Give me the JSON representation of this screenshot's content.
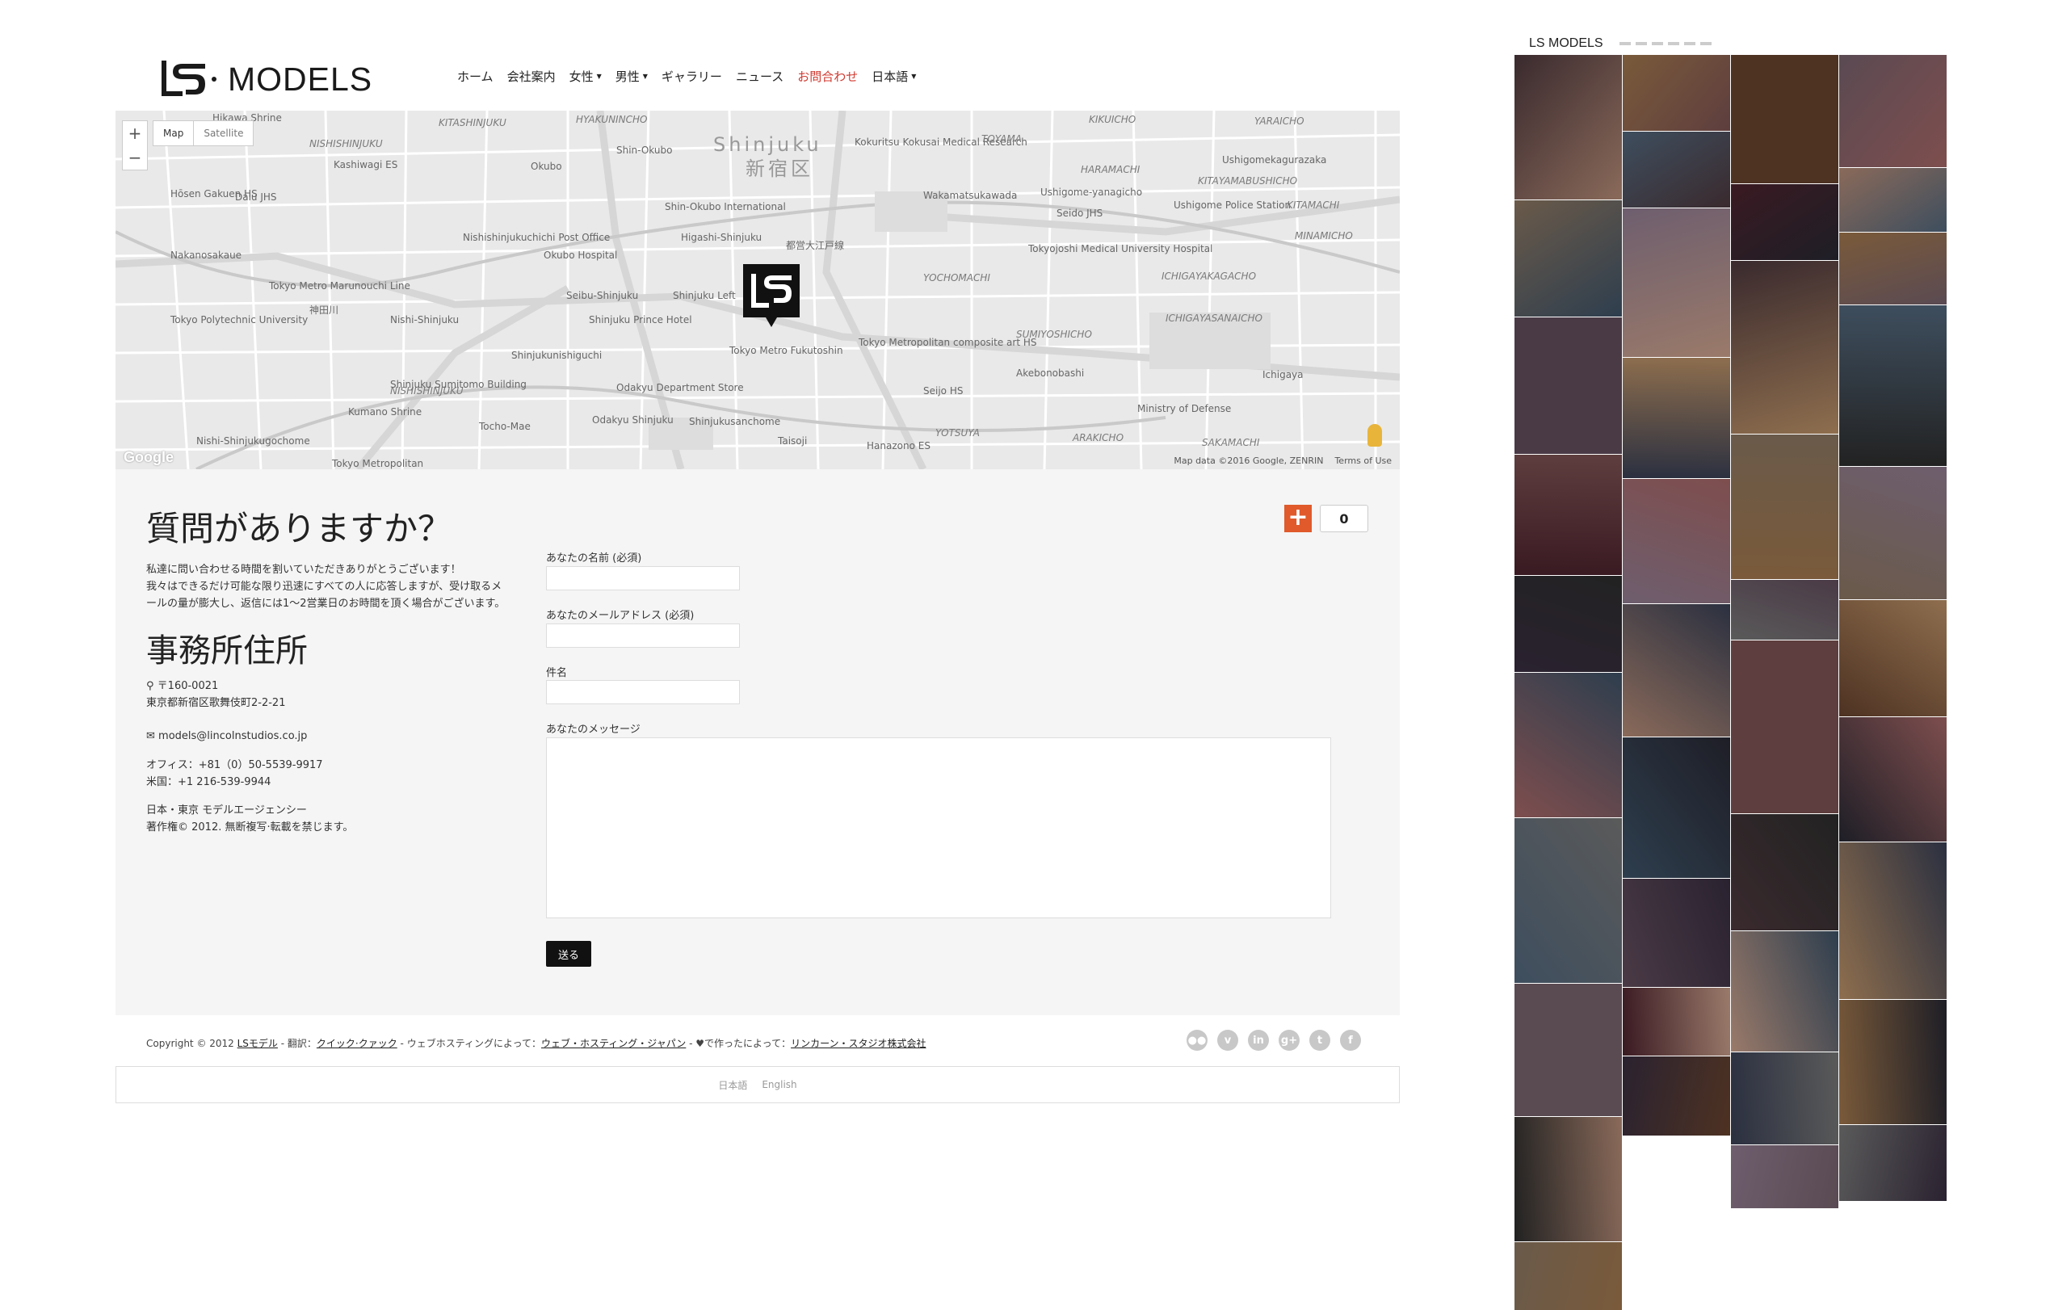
{
  "header": {
    "logo_text": "MODELS",
    "nav": [
      {
        "label": "ホーム",
        "dropdown": false,
        "active": false
      },
      {
        "label": "会社案内",
        "dropdown": false,
        "active": false
      },
      {
        "label": "女性",
        "dropdown": true,
        "active": false
      },
      {
        "label": "男性",
        "dropdown": true,
        "active": false
      },
      {
        "label": "ギャラリー",
        "dropdown": false,
        "active": false
      },
      {
        "label": "ニュース",
        "dropdown": false,
        "active": false
      },
      {
        "label": "お問合わせ",
        "dropdown": false,
        "active": true
      },
      {
        "label": "日本語",
        "dropdown": true,
        "active": false
      }
    ]
  },
  "map": {
    "zoom_in": "+",
    "zoom_out": "−",
    "type_map": "Map",
    "type_satellite": "Satellite",
    "google_logo": "Google",
    "attribution": "Map data ©2016 Google, ZENRIN",
    "terms": "Terms of Use",
    "labels": [
      {
        "t": "Hikawa Shrine",
        "c": ""
      },
      {
        "t": "NISHISHINJUKU",
        "c": "it"
      },
      {
        "t": "HYAKUNINCHO",
        "c": "it"
      },
      {
        "t": "KITASHINJUKU",
        "c": "it"
      },
      {
        "t": "Shinjuku",
        "c": "big"
      },
      {
        "t": "新宿区",
        "c": "big"
      },
      {
        "t": "KIKUICHO",
        "c": "it"
      },
      {
        "t": "YARAICHO",
        "c": "it"
      },
      {
        "t": "Kashiwagi ES",
        "c": ""
      },
      {
        "t": "Okubo",
        "c": ""
      },
      {
        "t": "Shin-Okubo",
        "c": ""
      },
      {
        "t": "Kokuritsu Kokusai Medical Research",
        "c": ""
      },
      {
        "t": "TOYAMA",
        "c": "it"
      },
      {
        "t": "HARAMACHI",
        "c": "it"
      },
      {
        "t": "KITAYAMABUSHICHO",
        "c": "it"
      },
      {
        "t": "Ushigomekagurazaka",
        "c": ""
      },
      {
        "t": "Hōsen Gakuen HS",
        "c": ""
      },
      {
        "t": "Daiu JHS",
        "c": ""
      },
      {
        "t": "Shin-Okubo International",
        "c": ""
      },
      {
        "t": "Wakamatsukawada",
        "c": ""
      },
      {
        "t": "Ushigome-yanagicho",
        "c": ""
      },
      {
        "t": "Ushigome Police Station",
        "c": ""
      },
      {
        "t": "KITAMACHI",
        "c": "it"
      },
      {
        "t": "Nishishinjukuchichi Post Office",
        "c": ""
      },
      {
        "t": "Higashi-Shinjuku",
        "c": ""
      },
      {
        "t": "都営大江戸線",
        "c": ""
      },
      {
        "t": "Seido JHS",
        "c": ""
      },
      {
        "t": "MINAMICHO",
        "c": "it"
      },
      {
        "t": "Nakanosakaue",
        "c": ""
      },
      {
        "t": "Tokyo Metro Marunouchi Line",
        "c": ""
      },
      {
        "t": "Okubo Hospital",
        "c": ""
      },
      {
        "t": "Tokyojoshi Medical University Hospital",
        "c": ""
      },
      {
        "t": "YOCHOMACHI",
        "c": "it"
      },
      {
        "t": "ICHIGAYAKAGACHO",
        "c": "it"
      },
      {
        "t": "Seibu-Shinjuku",
        "c": ""
      },
      {
        "t": "Shinjuku Prince Hotel",
        "c": ""
      },
      {
        "t": "Shinjuku Left",
        "c": ""
      },
      {
        "t": "神田川",
        "c": ""
      },
      {
        "t": "Tokyo Polytechnic University",
        "c": ""
      },
      {
        "t": "Nishi-Shinjuku",
        "c": ""
      },
      {
        "t": "ICHIGAYASANAICHO",
        "c": "it"
      },
      {
        "t": "SUMIYOSHICHO",
        "c": "it"
      },
      {
        "t": "Shinjukunishiguchi",
        "c": ""
      },
      {
        "t": "Tokyo Metropolitan composite art HS",
        "c": ""
      },
      {
        "t": "NISHISHINJUKU",
        "c": "it"
      },
      {
        "t": "Shinjuku Sumitomo Building",
        "c": ""
      },
      {
        "t": "Odakyu Department Store",
        "c": ""
      },
      {
        "t": "Akebonobashi",
        "c": ""
      },
      {
        "t": "Ichigaya",
        "c": ""
      },
      {
        "t": "Kumano Shrine",
        "c": ""
      },
      {
        "t": "Tocho-Mae",
        "c": ""
      },
      {
        "t": "Seijo HS",
        "c": ""
      },
      {
        "t": "Ministry of Defense",
        "c": ""
      },
      {
        "t": "Odakyu Shinjuku",
        "c": ""
      },
      {
        "t": "Shinjukusanchome",
        "c": ""
      },
      {
        "t": "YOTSUYA",
        "c": "it"
      },
      {
        "t": "ARAKICHO",
        "c": "it"
      },
      {
        "t": "SAKAMACHI",
        "c": "it"
      },
      {
        "t": "Nishi-Shinjukugochome",
        "c": ""
      },
      {
        "t": "Taisoji",
        "c": ""
      },
      {
        "t": "Hanazono ES",
        "c": ""
      },
      {
        "t": "Tokyo Metropolitan",
        "c": ""
      },
      {
        "t": "Tokyo Metro Fukutoshin",
        "c": ""
      }
    ]
  },
  "contact": {
    "title": "質問がありますか？",
    "intro": [
      "私達に問い合わせる時間を割いていただきありがとうございます！",
      "我々はできるだけ可能な限り迅速にすべての人に応答しますが、受け取るメ",
      "ールの量が膨大し、返信には1〜2営業日のお時間を頂く場合がございます。"
    ],
    "office_title": "事務所住所",
    "postal": "〒160-0021",
    "address": "東京都新宿区歌舞伎町2-2-21",
    "email": "models@lincolnstudios.co.jp",
    "phone_office": "オフィス：+81（0）50-5539-9917",
    "phone_us": "米国：+1 216-539-9944",
    "agency": "日本・東京 モデルエージェンシー",
    "rights": "著作権© 2012. 無断複写·転載を禁じます。"
  },
  "form": {
    "name_label": "あなたの名前 (必須)",
    "email_label": "あなたのメールアドレス (必須)",
    "subject_label": "件名",
    "message_label": "あなたのメッセージ",
    "name_value": "",
    "email_value": "",
    "subject_value": "",
    "message_value": "",
    "submit": "送る"
  },
  "gplus": {
    "icon": "+",
    "count": "0"
  },
  "footer": {
    "copyright_prefix": "Copyright © 2012 ",
    "brand_link": "LSモデル",
    "translation_prefix": " - 翻訳：",
    "translation_link": "クイック·クァック",
    "hosting_prefix": " - ウェブホスティングによって：",
    "hosting_link": "ウェブ・ホスティング・ジャパン",
    "made_prefix": " - ♥で作ったによって：",
    "made_link": "リンカーン・スタジオ株式会社",
    "socials": [
      "flickr-icon",
      "vimeo-icon",
      "linkedin-icon",
      "googleplus-icon",
      "twitter-icon",
      "facebook-icon"
    ],
    "lang_ja": "日本語",
    "lang_en": "English"
  },
  "thumb": {
    "logo": "LS MODELS"
  },
  "colors": {
    "accent": "#d0392f",
    "gplus": "#e05a2b",
    "dark": "#111111",
    "content_bg": "#f5f5f5"
  }
}
